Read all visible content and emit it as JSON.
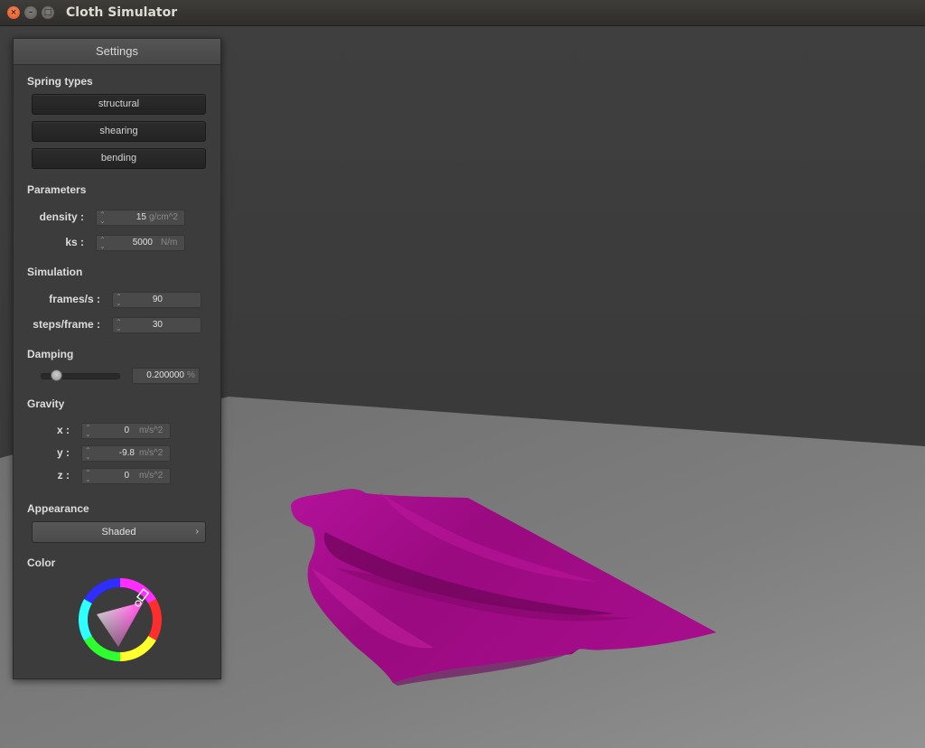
{
  "window": {
    "title": "Cloth Simulator",
    "close_glyph": "×",
    "minimize_glyph": "–",
    "maximize_glyph": "□"
  },
  "panel": {
    "title": "Settings",
    "spring_types": {
      "heading": "Spring types",
      "buttons": [
        "structural",
        "shearing",
        "bending"
      ]
    },
    "parameters": {
      "heading": "Parameters",
      "density": {
        "label": "density :",
        "value": "15",
        "unit": "g/cm^2"
      },
      "ks": {
        "label": "ks :",
        "value": "5000",
        "unit": "N/m"
      }
    },
    "simulation": {
      "heading": "Simulation",
      "fps": {
        "label": "frames/s :",
        "value": "90"
      },
      "steps": {
        "label": "steps/frame :",
        "value": "30"
      }
    },
    "damping": {
      "heading": "Damping",
      "value": "0.200000",
      "unit": "%",
      "slider_fraction": 0.2
    },
    "gravity": {
      "heading": "Gravity",
      "x": {
        "label": "x :",
        "value": "0",
        "unit": "m/s^2"
      },
      "y": {
        "label": "y :",
        "value": "-9.8",
        "unit": "m/s^2"
      },
      "z": {
        "label": "z :",
        "value": "0",
        "unit": "m/s^2"
      }
    },
    "appearance": {
      "heading": "Appearance",
      "selected": "Shaded",
      "arrow_glyph": "›"
    },
    "color": {
      "heading": "Color",
      "selected_hex": "#9c0a82"
    }
  },
  "scene": {
    "background_color": "#3b3b3b",
    "floor_color": "#7a7a7a",
    "cloth_color": "#9c0a82"
  }
}
